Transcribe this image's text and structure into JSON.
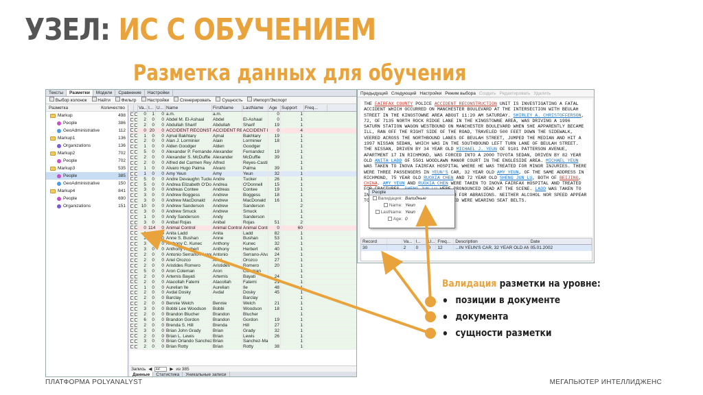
{
  "slide": {
    "title_part1": "УЗЕЛ:",
    "title_part2": "ИС С ОБУЧЕНИЕМ",
    "subtitle": "Разметка данных для обучения",
    "footer_left": "ПЛАТФОРМА POLYANALYST",
    "footer_right": "МЕГАПЬЮТЕР ИНТЕЛЛИДЖЕНС",
    "validation_word": "Валидация",
    "validation_rest": " разметки на уровне:",
    "bullets": [
      "позиции в документе",
      "документа",
      "сущности разметки"
    ],
    "accent_color": "#e8a33c"
  },
  "app": {
    "tabs": [
      "Тексты",
      "Разметки",
      "Модели",
      "Сравнение",
      "Настройки"
    ],
    "active_tab": "Разметки",
    "toolbar": [
      "Выбор колонок",
      "Найти",
      "Фильтр",
      "Настройки",
      "Сгенерировать",
      "Сущность",
      "Импорт/Экспорт"
    ],
    "left_head": {
      "name": "Разметка",
      "count": "Количество"
    },
    "tree": [
      {
        "label": "Markup",
        "count": "498",
        "kind": "folder",
        "indent": 6
      },
      {
        "label": "People",
        "count": "386",
        "kind": "dot",
        "color": "#c94fc9",
        "indent": 16
      },
      {
        "label": "GeoAdministrative",
        "count": "112",
        "kind": "dot",
        "color": "#4a9be0",
        "indent": 16
      },
      {
        "label": "Markup1",
        "count": "136",
        "kind": "folder",
        "indent": 6
      },
      {
        "label": "Organizations",
        "count": "136",
        "kind": "dot",
        "color": "#7b5bd6",
        "indent": 16
      },
      {
        "label": "Markup2",
        "count": "702",
        "kind": "folder",
        "indent": 6
      },
      {
        "label": "People",
        "count": "702",
        "kind": "dot",
        "color": "#c94fc9",
        "indent": 16
      },
      {
        "label": "Markup3",
        "count": "535",
        "kind": "folder",
        "indent": 6
      },
      {
        "label": "People",
        "count": "385",
        "kind": "dot",
        "color": "#c94fc9",
        "indent": 16,
        "selected": true
      },
      {
        "label": "GeoAdministrative",
        "count": "150",
        "kind": "dot",
        "color": "#4a9be0",
        "indent": 16
      },
      {
        "label": "Markup4",
        "count": "841",
        "kind": "folder",
        "indent": 6
      },
      {
        "label": "People",
        "count": "690",
        "kind": "dot",
        "color": "#c94fc9",
        "indent": 16
      },
      {
        "label": "Organizations",
        "count": "151",
        "kind": "dot",
        "color": "#7b5bd6",
        "indent": 16
      }
    ],
    "grid_headers": [
      "",
      "",
      "Va...",
      "I...",
      "U...",
      "Name",
      "FirstName",
      "LastName",
      "Age",
      "Support",
      "Freq..."
    ],
    "grid_rows": [
      [
        "0",
        "1",
        "0",
        "a.m.",
        "a.m.",
        "",
        "0",
        "1",
        "ok"
      ],
      [
        "2",
        "0",
        "0",
        "Abdel M. El-Ashaal",
        "Abdel",
        "El-Ashaal",
        "0",
        "1",
        "ok"
      ],
      [
        "2",
        "0",
        "0",
        "Abdullah Sharif",
        "Abdullah",
        "Sharif",
        "19",
        "1",
        "ok"
      ],
      [
        "0",
        "20",
        "0",
        "ACCIDENT RECONSTRUCTI",
        "ACCIDENT REC",
        "ACCIDENT REC",
        "0",
        "4",
        "hl"
      ],
      [
        "1",
        "0",
        "0",
        "Ajmal Bakhtary",
        "Ajmal",
        "Bakhtary",
        "19",
        "1",
        "ok"
      ],
      [
        "2",
        "0",
        "0",
        "Alan J. Lorminier",
        "Alain",
        "Lorminier",
        "18",
        "1",
        "ok"
      ],
      [
        "1",
        "0",
        "0",
        "Alden Goodger",
        "Alden",
        "Goodger",
        "",
        "1",
        "ok"
      ],
      [
        "5",
        "0",
        "0",
        "Alexander P. Fernandez",
        "Alexander",
        "Fernandez",
        "19",
        "1",
        "ok"
      ],
      [
        "2",
        "0",
        "0",
        "Alexander S. McDuffie",
        "Alexander",
        "McDuffie",
        "39",
        "1",
        "ok"
      ],
      [
        "2",
        "0",
        "0",
        "Alfred del Carmen Reyes-C",
        "Alfred",
        "Reyes-Castillo",
        "",
        "1",
        "ok"
      ],
      [
        "1",
        "0",
        "0",
        "Alvaro Hugo Palma",
        "Alvaro",
        "Palma",
        "39",
        "1",
        "ok"
      ],
      [
        "1",
        "0",
        "0",
        "Amy Yeun",
        "Amy",
        "Yeun",
        "32",
        "1",
        "blue"
      ],
      [
        "5",
        "0",
        "0",
        "Andre Devaughn Tucker",
        "Andre",
        "Tucker",
        "26",
        "1",
        "ok"
      ],
      [
        "5",
        "0",
        "0",
        "Andrea Elizabeth O'Donnell",
        "Andrea",
        "O'Donnell",
        "15",
        "1",
        "ok"
      ],
      [
        "3",
        "0",
        "0",
        "Andreas Contee",
        "Andreas",
        "Contee",
        "19",
        "1",
        "ok"
      ],
      [
        "3",
        "0",
        "0",
        "Andrew Boggess",
        "Andrew",
        "Boggess",
        "18",
        "1",
        "ok"
      ],
      [
        "3",
        "0",
        "0",
        "Andrew MacDonald",
        "Andrew",
        "MacDonald",
        "16",
        "1",
        "ok"
      ],
      [
        "10",
        "0",
        "0",
        "Andrew Sanderson",
        "Andrew",
        "Sanderson",
        "",
        "2",
        "ok"
      ],
      [
        "3",
        "0",
        "0",
        "Andrew Smuck",
        "Andrew",
        "Smuck",
        "",
        "1",
        "ok"
      ],
      [
        "1",
        "0",
        "0",
        "Andy Sanderson",
        "Andy",
        "Sanderson",
        "",
        "1",
        "ok"
      ],
      [
        "3",
        "0",
        "0",
        "Anibal Rojas",
        "Anibal",
        "Rojas",
        "51",
        "2",
        "ok"
      ],
      [
        "0",
        "114",
        "0",
        "Animal Control",
        "Animal Control",
        "Animal Control",
        "0",
        "60",
        "hl"
      ],
      [
        "1",
        "0",
        "0",
        "Anita Ladd",
        "Anita",
        "Ladd",
        "82",
        "1",
        "ok"
      ],
      [
        "2",
        "0",
        "0",
        "Anne S. Bushan",
        "Anne",
        "Bushan",
        "53",
        "1",
        "ok"
      ],
      [
        "3",
        "0",
        "0",
        "Anthony C. Kunec",
        "Anthony",
        "Kunec",
        "32",
        "1",
        "ok"
      ],
      [
        "3",
        "0",
        "0",
        "Anthony Herbert",
        "Anthony",
        "Herbert",
        "40",
        "1",
        "ok"
      ],
      [
        "2",
        "0",
        "0",
        "Antonio Serrano-Alvarez",
        "Antonio",
        "Serrano-Alvare",
        "24",
        "1",
        "ok"
      ],
      [
        "2",
        "0",
        "0",
        "Ariel Orozco",
        "Ariel",
        "Orozco",
        "27",
        "1",
        "ok"
      ],
      [
        "2",
        "0",
        "0",
        "Aristides Romero",
        "Aristides",
        "Romero",
        "20",
        "1",
        "ok"
      ],
      [
        "5",
        "0",
        "0",
        "Aron Coleman",
        "Aron",
        "Coleman",
        "",
        "1",
        "ok"
      ],
      [
        "2",
        "0",
        "0",
        "Artemis Bayati",
        "Artemis",
        "Bayati",
        "24",
        "1",
        "ok"
      ],
      [
        "2",
        "0",
        "0",
        "Atacollah Fatemi",
        "Atacollah",
        "Fatemi",
        "21",
        "1",
        "ok"
      ],
      [
        "1",
        "0",
        "0",
        "Aurelian Ile",
        "Aurelian",
        "Ile",
        "48",
        "1",
        "ok"
      ],
      [
        "2",
        "0",
        "0",
        "Avdal Dosky",
        "Avdal",
        "Dosky",
        "45",
        "1",
        "ok"
      ],
      [
        "2",
        "0",
        "0",
        "Barclay",
        "",
        "Barclay",
        "",
        "1",
        "ok"
      ],
      [
        "2",
        "0",
        "0",
        "Bennie Welch",
        "Bennie",
        "Welch",
        "21",
        "1",
        "ok"
      ],
      [
        "3",
        "0",
        "0",
        "Bobbi Lee Woodson",
        "Bobbi",
        "Woodson",
        "18",
        "1",
        "ok"
      ],
      [
        "2",
        "0",
        "0",
        "Brandon Blucher",
        "Brandon",
        "Blucher",
        "",
        "1",
        "ok"
      ],
      [
        "6",
        "0",
        "0",
        "Brandon Gordon",
        "Brandon",
        "Gordon",
        "19",
        "1",
        "ok"
      ],
      [
        "2",
        "0",
        "0",
        "Brenda S. Hill",
        "Brenda",
        "Hill",
        "27",
        "1",
        "ok"
      ],
      [
        "3",
        "0",
        "0",
        "Brian John Grady",
        "Brian",
        "Grady",
        "32",
        "1",
        "ok"
      ],
      [
        "2",
        "0",
        "0",
        "Brian L. Lewis",
        "Brian",
        "Lewis",
        "26",
        "1",
        "ok"
      ],
      [
        "3",
        "0",
        "0",
        "Brian Orlando Sanchez-Marad",
        "Brian",
        "Sanchez-Marad",
        "",
        "1",
        "ok"
      ],
      [
        "2",
        "0",
        "0",
        "Brian Rotty",
        "Brian",
        "Rotty",
        "38",
        "1",
        "ok"
      ]
    ],
    "pager": {
      "label": "Запись",
      "value": "12",
      "of": "из 385"
    },
    "bottom_tabs": [
      "Данные",
      "Статистика",
      "Уникальные записи"
    ]
  },
  "doc": {
    "toolbar": [
      "Предыдущий",
      "Следующий",
      "Настройки",
      "Режим выбора",
      "Создать",
      "Редактировать",
      "Удалить"
    ],
    "disabled_from": 4,
    "text_html_safe": [
      [
        "THE ",
        ""
      ],
      [
        "FAIRFAX COUNTY",
        "annr"
      ],
      [
        " POLICE ",
        ""
      ],
      [
        "ACCIDENT RECONSTRUCTION",
        "annr"
      ],
      [
        " UNIT IS INVESTIGATING A FATAL ACCIDENT WHICH OCCURRED ON MANCHESTER BOULEVARD AT THE INTERSECTION WITH BEULAH STREET IN THE KINGSTOWNE AREA ABOUT 11:20 AM SATURDAY. ",
        ""
      ],
      [
        "SHIRLEY A. CHRISTOFFERSON",
        "ann"
      ],
      [
        ", 72, OF 7135 NORTH ROCK RIDGE LANE IN THE KINGSTOWNE AREA, WAS DRIVING A 1996 SATURN STATION WAGON WESTBOUND ON MANCHESTER BOULEVARD WHEN SHE APPARENTLY BECAME ILL, RAN OFF THE RIGHT SIDE OF THE ROAD, TRAVELED 500 FEET DOWN THE SIDEWALK, VEERED ACROSS THE NORTHBOUND LANES OF BEULAH STREET, JUMPED THE MEDIAN AND HIT A 1997 NISSAN SEDAN, WHICH WAS IN THE SOUTHBOUND LEFT TURN LANE OF BEULAH STREET. THE NISSAN, DRIVEN BY 34 YEAR OLD ",
        ""
      ],
      [
        "MICHAEL J. YEUN",
        "ann"
      ],
      [
        " OF 9101 PATTERSON AVENUE, APARTMENT 17 IN RICHMOND, WAS FORCED INTO A 2000 TOYOTA SEDAN, DRIVEN BY 82 YEAR OLD ",
        ""
      ],
      [
        "ANITA LADD",
        "ann"
      ],
      [
        " OF 5501 WOODLAWN MANOR COURT IN THE ENGLESIDE AREA. ",
        ""
      ],
      [
        "MICHAEL YEUN",
        "ann"
      ],
      [
        " WAS TAKEN TO INOVA FAIRFAX HOSPITAL WHERE HE WAS TREATED FOR MINOR INJURIES. THERE WERE THREE PASSENGERS IN ",
        ""
      ],
      [
        "YEUN'S",
        "ann"
      ],
      [
        " CAR, 32 YEAR OLD ",
        ""
      ],
      [
        "AMY YEUN",
        "ann"
      ],
      [
        ", OF THE SAME ADDRESS IN RICHMOND, 75 YEAR OLD ",
        ""
      ],
      [
        "RUOXIA CHEN",
        "ann"
      ],
      [
        " AND 72 YEAR OLD ",
        ""
      ],
      [
        "SHENG JUN LU",
        "ann"
      ],
      [
        ", BOTH OF ",
        ""
      ],
      [
        "BEIJING",
        "annr"
      ],
      [
        ", ",
        ""
      ],
      [
        "CHINA",
        "annr"
      ],
      [
        ". ",
        ""
      ],
      [
        "AMY YEUN",
        "ann"
      ],
      [
        " AND ",
        ""
      ],
      [
        "RUOXIA CHEN",
        "ann"
      ],
      [
        " WERE TAKEN TO INOVA FAIRFAX HOSPITAL AND TREATED FOR FRACTURES. ",
        ""
      ],
      [
        "SHENG JUN LU",
        "ann"
      ],
      [
        " WERE PRONOUNCED DEAD AT THE SCENE. ",
        ""
      ],
      [
        "LADD",
        "ann"
      ],
      [
        " WAS TAKEN TO INOVA FAIRFAX HOSPITAL AND TREATED FOR ABRASIONS. NEITHER ALCOHOL NOR SPEED APPEAR TO BE FACTORS. ALL PARTIES INVOLVED WERE WEARING SEAT BELTS.",
        ""
      ]
    ],
    "popup": {
      "title": "People",
      "rows": [
        {
          "k": "Валидация:",
          "v": "Валидные"
        },
        {
          "k": "Name:",
          "v": "Yeun"
        },
        {
          "k": "LastName:",
          "v": "Yeun"
        },
        {
          "k": "Age:",
          "v": "0"
        }
      ]
    },
    "mini_headers": [
      "Record",
      "",
      "Va...",
      "I...",
      "U...",
      "Freq...",
      "Description",
      "Date"
    ],
    "mini_row": [
      "30",
      "",
      "2",
      "0",
      "0",
      "12",
      "...IN YEUN'S CAR, 32 YEAR OLD AMY",
      "05.01.2002"
    ]
  }
}
